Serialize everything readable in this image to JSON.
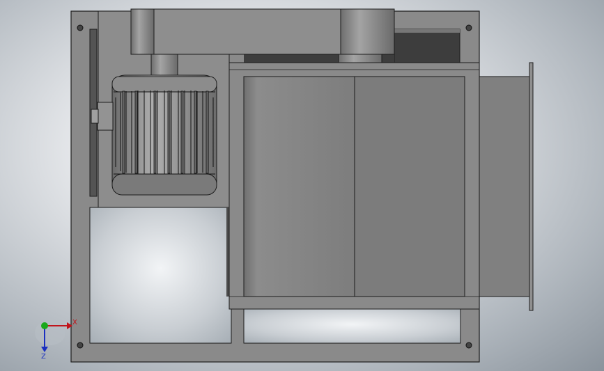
{
  "triad": {
    "x_label": "X",
    "z_label": "Z",
    "x_color": "#c0141b",
    "y_color": "#1aa81a",
    "z_color": "#1a2fc0"
  },
  "colors": {
    "part_fill": "#878787",
    "dark_fill": "#5b5b5b",
    "outline": "#1c1c1c",
    "motor_fill": "#9a9a9a"
  },
  "icons": [
    "mounting-hole-icon",
    "axis-triad-icon"
  ]
}
